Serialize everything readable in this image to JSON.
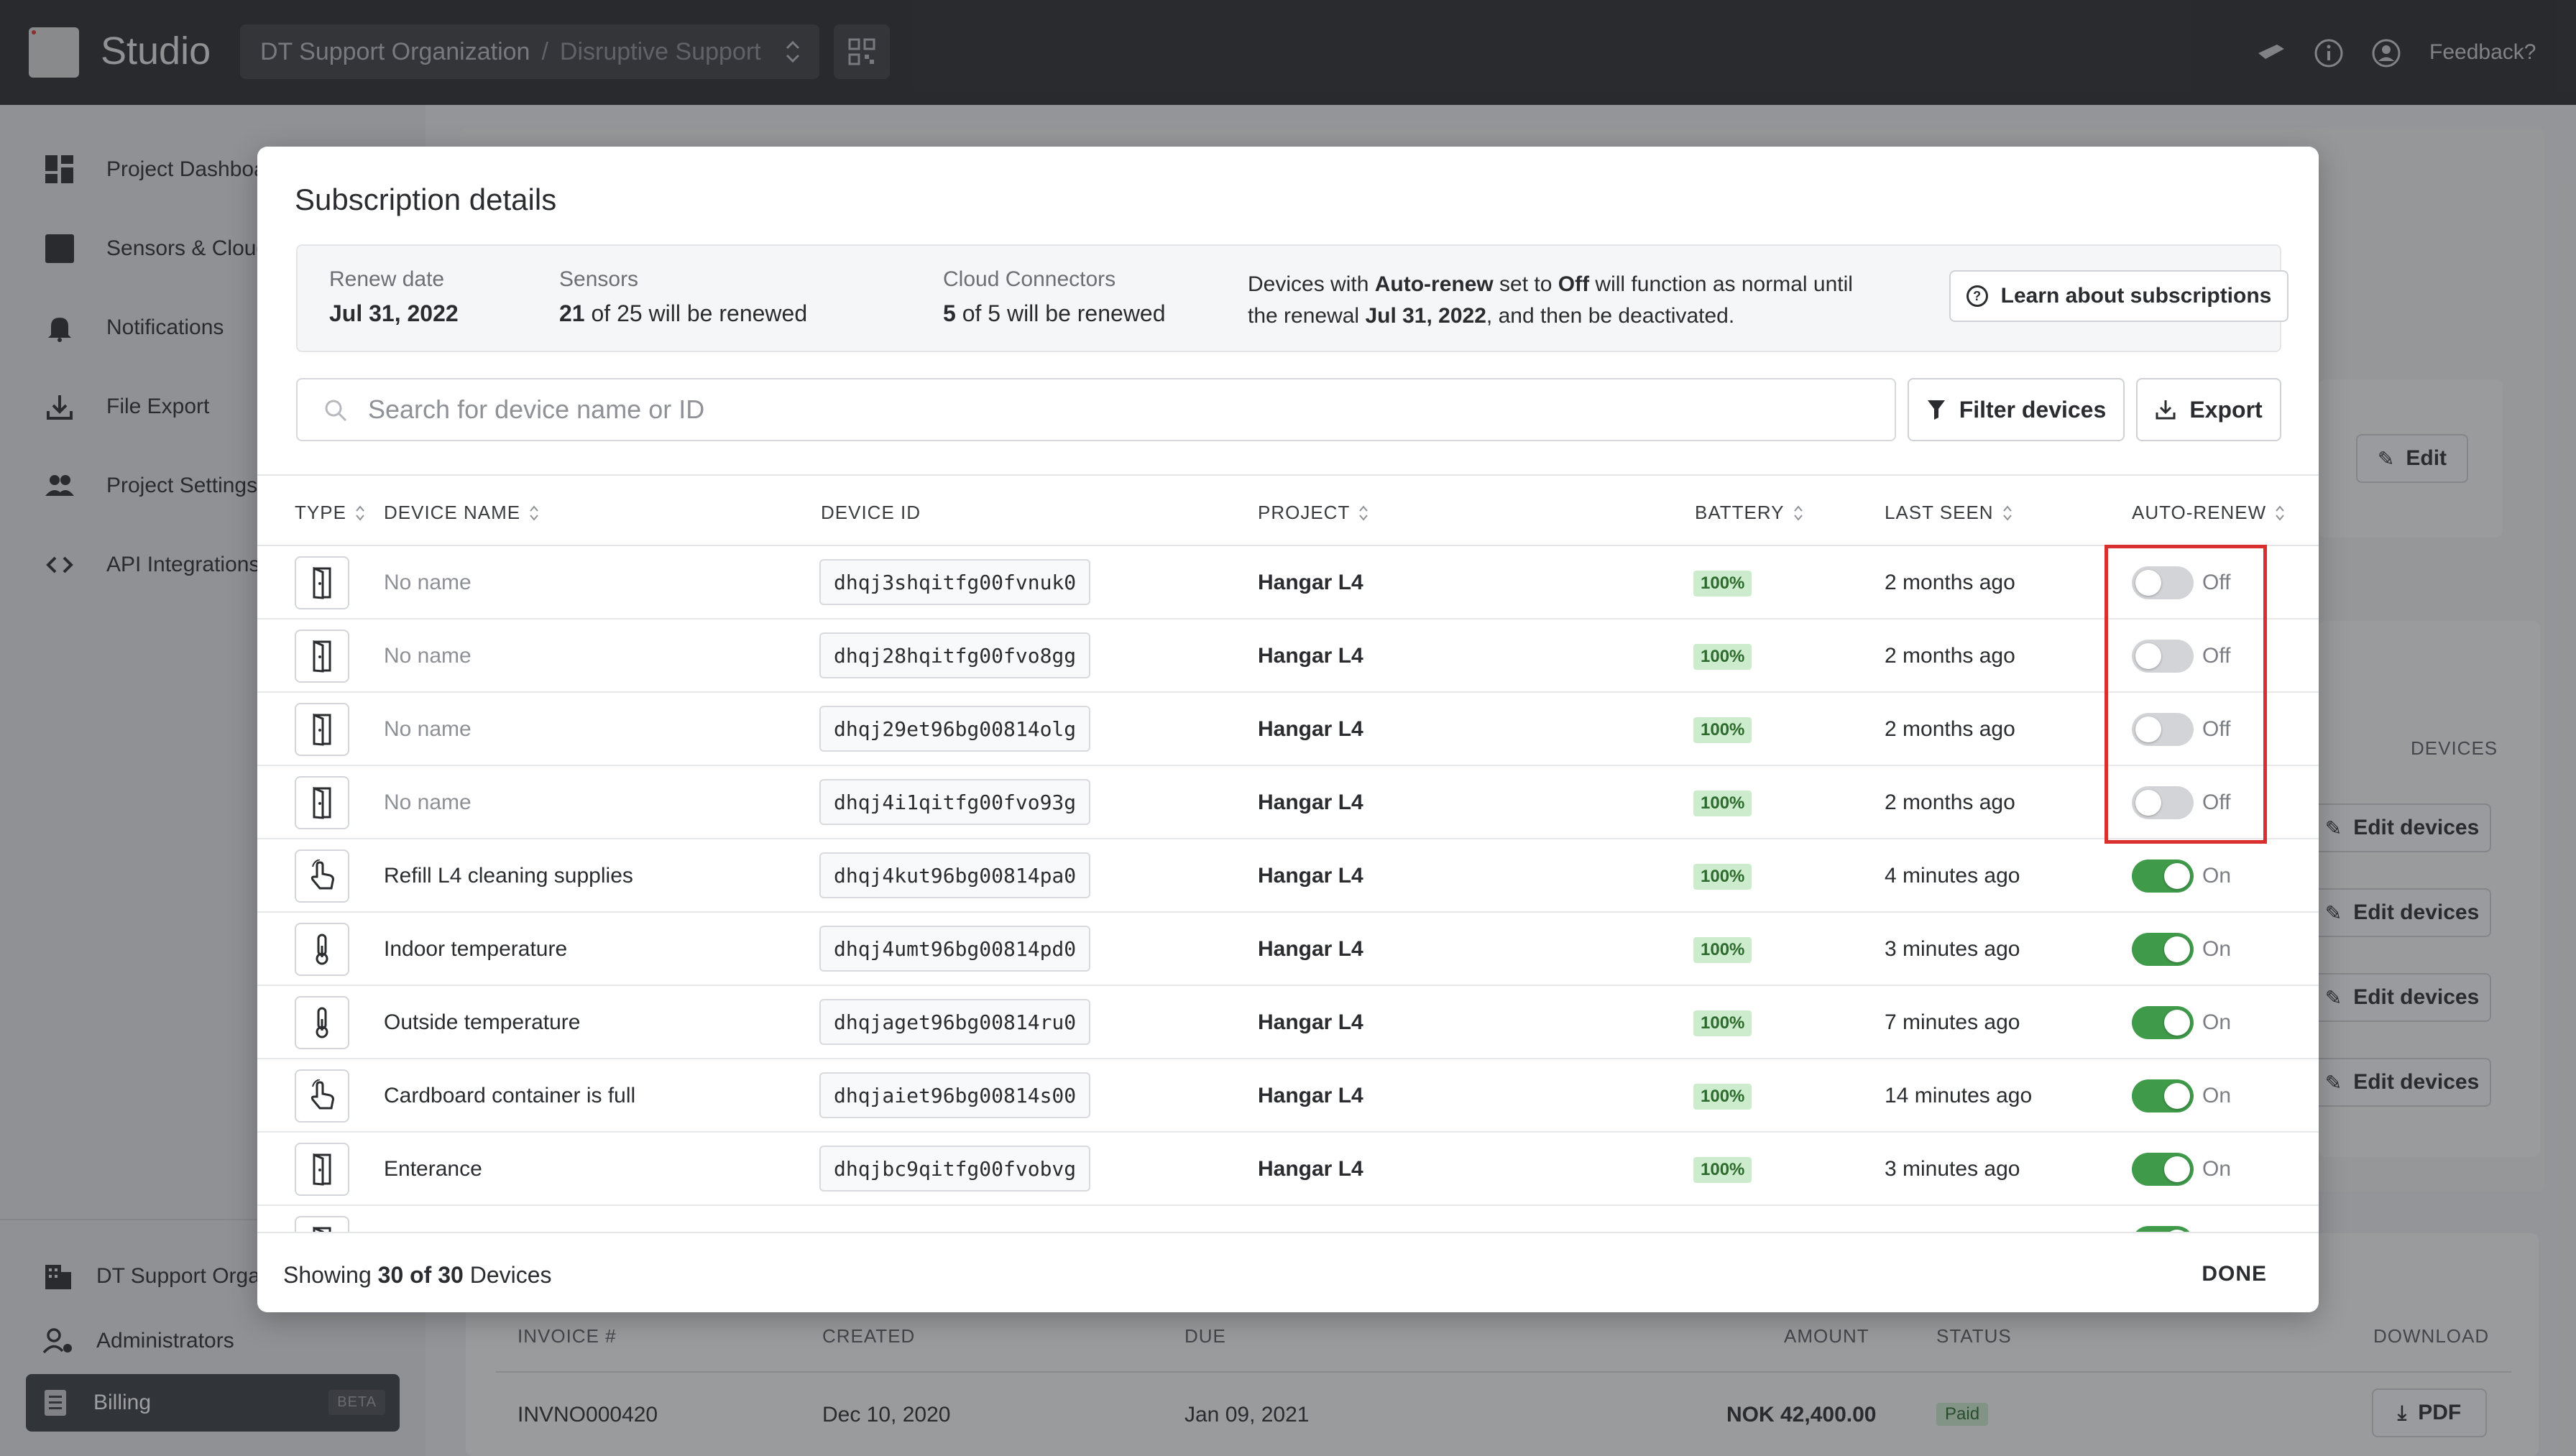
{
  "topbar": {
    "app_title": "Studio",
    "organization": "DT Support Organization",
    "separator": "/",
    "project": "Disruptive Support",
    "feedback": "Feedback?"
  },
  "sidebar": {
    "items": [
      {
        "label": "Project Dashboard",
        "icon": "dashboard-icon"
      },
      {
        "label": "Sensors & Cloud",
        "icon": "sensors-icon"
      },
      {
        "label": "Notifications",
        "icon": "bell-icon"
      },
      {
        "label": "File Export",
        "icon": "download-icon"
      },
      {
        "label": "Project Settings",
        "icon": "people-icon"
      },
      {
        "label": "API Integrations",
        "icon": "code-icon"
      }
    ],
    "bottom_items": [
      {
        "label": "DT Support Organization",
        "icon": "building-icon"
      },
      {
        "label": "Administrators",
        "icon": "admin-icon"
      },
      {
        "label": "Billing",
        "icon": "billing-icon",
        "badge": "BETA"
      }
    ]
  },
  "background": {
    "edit_label": "Edit",
    "devices_header": "DEVICES",
    "edit_devices_label": "Edit devices",
    "invoice_headers": [
      "INVOICE #",
      "CREATED",
      "DUE",
      "AMOUNT",
      "STATUS",
      "DOWNLOAD"
    ],
    "invoice_row": {
      "number": "INVNO000420",
      "created": "Dec 10, 2020",
      "due": "Jan 09, 2021",
      "amount": "NOK 42,400.00",
      "status": "Paid",
      "download": "PDF"
    }
  },
  "modal": {
    "title": "Subscription details",
    "summary": {
      "renew_label": "Renew date",
      "renew_value": "Jul 31, 2022",
      "sensors_label": "Sensors",
      "sensors_count": "21",
      "sensors_rest": "of 25 will be renewed",
      "connectors_label": "Cloud Connectors",
      "connectors_count": "5",
      "connectors_rest": "of 5 will be renewed",
      "note_1": "Devices with ",
      "note_autorenew": "Auto-renew",
      "note_2": " set to ",
      "note_off": "Off",
      "note_3": " will function as normal until the renewal ",
      "note_date": "Jul 31, 2022",
      "note_4": ", and then be deactivated.",
      "learn_button": "Learn about subscriptions"
    },
    "search_placeholder": "Search for device name or ID",
    "filter_button": "Filter devices",
    "export_button": "Export",
    "columns": {
      "type": "TYPE",
      "device_name": "DEVICE NAME",
      "device_id": "DEVICE ID",
      "project": "PROJECT",
      "battery": "BATTERY",
      "last_seen": "LAST SEEN",
      "auto_renew": "AUTO-RENEW"
    },
    "rows": [
      {
        "type": "door-sensor-icon",
        "name": "No name",
        "id": "dhqj3shqitfg00fvnuk0",
        "project": "Hangar L4",
        "battery": "100%",
        "last_seen": "2 months ago",
        "auto_renew": "Off"
      },
      {
        "type": "door-sensor-icon",
        "name": "No name",
        "id": "dhqj28hqitfg00fvo8gg",
        "project": "Hangar L4",
        "battery": "100%",
        "last_seen": "2 months ago",
        "auto_renew": "Off"
      },
      {
        "type": "door-sensor-icon",
        "name": "No name",
        "id": "dhqj29et96bg00814olg",
        "project": "Hangar L4",
        "battery": "100%",
        "last_seen": "2 months ago",
        "auto_renew": "Off"
      },
      {
        "type": "door-sensor-icon",
        "name": "No name",
        "id": "dhqj4i1qitfg00fvo93g",
        "project": "Hangar L4",
        "battery": "100%",
        "last_seen": "2 months ago",
        "auto_renew": "Off"
      },
      {
        "type": "touch-sensor-icon",
        "name": "Refill L4 cleaning supplies",
        "id": "dhqj4kut96bg00814pa0",
        "project": "Hangar L4",
        "battery": "100%",
        "last_seen": "4 minutes ago",
        "auto_renew": "On"
      },
      {
        "type": "temperature-sensor-icon",
        "name": "Indoor temperature",
        "id": "dhqj4umt96bg00814pd0",
        "project": "Hangar L4",
        "battery": "100%",
        "last_seen": "3 minutes ago",
        "auto_renew": "On"
      },
      {
        "type": "temperature-sensor-icon",
        "name": "Outside temperature",
        "id": "dhqjaget96bg00814ru0",
        "project": "Hangar L4",
        "battery": "100%",
        "last_seen": "7 minutes ago",
        "auto_renew": "On"
      },
      {
        "type": "touch-sensor-icon",
        "name": "Cardboard container is full",
        "id": "dhqjaiet96bg00814s00",
        "project": "Hangar L4",
        "battery": "100%",
        "last_seen": "14 minutes ago",
        "auto_renew": "On"
      },
      {
        "type": "door-sensor-icon",
        "name": "Enterance",
        "id": "dhqjbc9qitfg00fvobvg",
        "project": "Hangar L4",
        "battery": "100%",
        "last_seen": "3 minutes ago",
        "auto_renew": "On"
      }
    ],
    "footer": {
      "showing_prefix": "Showing ",
      "showing_count": "30 of 30",
      "showing_suffix": " Devices",
      "done": "DONE"
    }
  },
  "colors": {
    "topbar": "#2a2b2e",
    "toggle_on": "#3f9a4a",
    "toggle_off": "#d2d4d7",
    "battery_bg": "#cdeccd",
    "highlight": "#d9302f"
  }
}
